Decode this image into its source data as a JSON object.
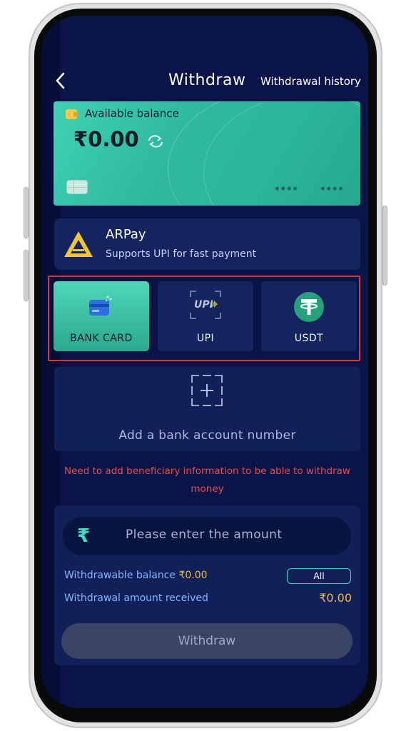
{
  "header": {
    "title": "Withdraw",
    "history_link": "Withdrawal history"
  },
  "balance_card": {
    "label": "Available balance",
    "amount": "₹0.00",
    "card_mask_1": "****",
    "card_mask_2": "****"
  },
  "payment_provider": {
    "name": "ARPay",
    "subtitle": "Supports UPI for fast payment"
  },
  "methods": [
    {
      "label": "BANK CARD",
      "icon": "bank-card-icon",
      "selected": true
    },
    {
      "label": "UPI",
      "icon": "upi-icon",
      "selected": false
    },
    {
      "label": "USDT",
      "icon": "tether-icon",
      "selected": false
    }
  ],
  "add_account": {
    "label": "Add a bank account number"
  },
  "warning": "Need to add beneficiary information to be able to withdraw money",
  "amount_panel": {
    "currency_symbol": "₹",
    "placeholder": "Please enter the amount",
    "withdrawable_label": "Withdrawable balance ",
    "withdrawable_value": "₹0.00",
    "all_button": "All",
    "received_label": "Withdrawal amount received",
    "received_value": "₹0.00",
    "withdraw_button": "Withdraw"
  },
  "colors": {
    "background": "#0b1448",
    "accent": "#3fd1b2",
    "warning": "#e74b4b",
    "highlight_border": "#d33a3a",
    "amount": "#f0b84a"
  }
}
